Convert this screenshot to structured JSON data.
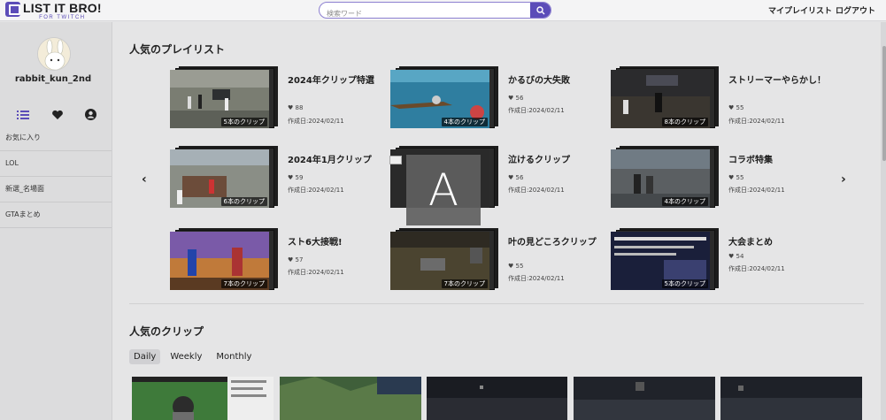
{
  "header": {
    "logo_title": "LIST IT BRO!",
    "logo_sub": "FOR TWITCH",
    "search_placeholder": "検索ワード",
    "nav": [
      "マイプレイリスト",
      "ログアウト"
    ]
  },
  "sidebar": {
    "username": "rabbit_kun_2nd",
    "icons": [
      "list-icon",
      "heart-icon",
      "user-circle-icon"
    ],
    "items": [
      "お気に入り",
      "LOL",
      "新選_名場面",
      "GTAまとめ"
    ]
  },
  "main": {
    "playlists_title": "人気のプレイリスト",
    "clips_title": "人気のクリップ",
    "tabs": [
      "Daily",
      "Weekly",
      "Monthly"
    ],
    "playlists": [
      {
        "title": "2024年クリップ特選",
        "likes": "88",
        "date": "作成日:2024/02/11",
        "count": "5本のクリップ"
      },
      {
        "title": "かるびの大失敗",
        "likes": "56",
        "date": "作成日:2024/02/11",
        "count": "4本のクリップ"
      },
      {
        "title": "ストリーマーやらかし！",
        "likes": "55",
        "date": "作成日:2024/02/11",
        "count": "8本のクリップ"
      },
      {
        "title": "2024年1月クリップ",
        "likes": "59",
        "date": "作成日:2024/02/11",
        "count": "6本のクリップ"
      },
      {
        "title": "泣けるクリップ",
        "likes": "56",
        "date": "作成日:2024/02/11",
        "count": ""
      },
      {
        "title": "コラボ特集",
        "likes": "55",
        "date": "作成日:2024/02/11",
        "count": "4本のクリップ"
      },
      {
        "title": "スト6大接戦!",
        "likes": "57",
        "date": "作成日:2024/02/11",
        "count": "7本のクリップ"
      },
      {
        "title": "叶の見どころクリップ",
        "likes": "55",
        "date": "作成日:2024/02/11",
        "count": "7本のクリップ"
      },
      {
        "title": "大会まとめ",
        "likes": "54",
        "date": "作成日:2024/02/11",
        "count": "5本のクリップ"
      }
    ],
    "overlay_letter": "A",
    "prev_arrow": "‹",
    "next_arrow": "›"
  },
  "colors": {
    "accent": "#5b4cb8",
    "background": "#e5e5e6",
    "sidebar": "#dcdcdd"
  }
}
